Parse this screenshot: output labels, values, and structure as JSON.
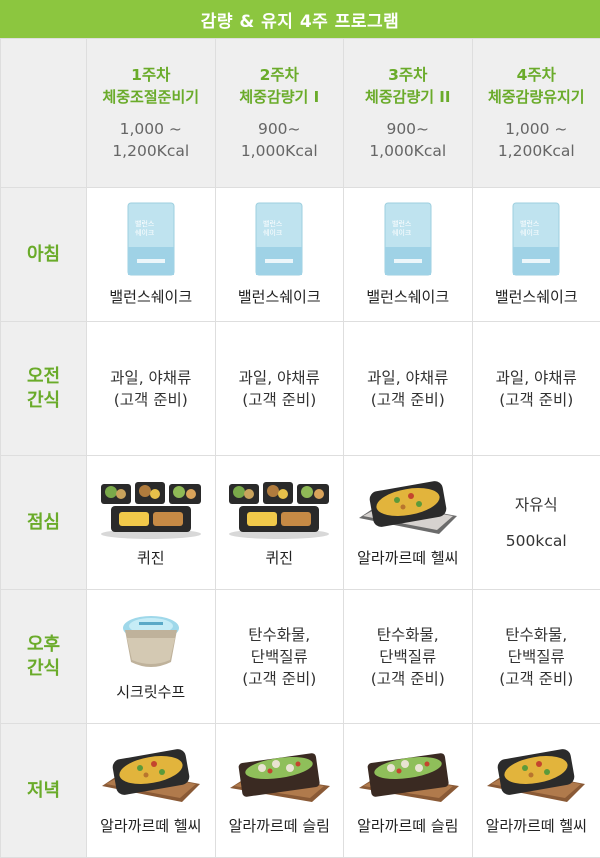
{
  "title": "감량 & 유지 4주 프로그램",
  "weeks": [
    {
      "label": "1주차",
      "phase": "체중조절준비기",
      "kcal_line1": "1,000 ~",
      "kcal_line2": "1,200Kcal"
    },
    {
      "label": "2주차",
      "phase": "체중감량기 I",
      "kcal_line1": "900~",
      "kcal_line2": "1,000Kcal"
    },
    {
      "label": "3주차",
      "phase": "체중감량기 II",
      "kcal_line1": "900~",
      "kcal_line2": "1,000Kcal"
    },
    {
      "label": "4주차",
      "phase": "체중감량유지기",
      "kcal_line1": "1,000 ~",
      "kcal_line2": "1,200Kcal"
    }
  ],
  "rows": {
    "breakfast": {
      "label": "아침",
      "cells": [
        "밸런스쉐이크",
        "밸런스쉐이크",
        "밸런스쉐이크",
        "밸런스쉐이크"
      ],
      "pack_text": "밸런스\n쉐이크"
    },
    "am_snack": {
      "label_line1": "오전",
      "label_line2": "간식",
      "cells": [
        {
          "line1": "과일, 야채류",
          "line2": "(고객 준비)"
        },
        {
          "line1": "과일, 야채류",
          "line2": "(고객 준비)"
        },
        {
          "line1": "과일, 야채류",
          "line2": "(고객 준비)"
        },
        {
          "line1": "과일, 야채류",
          "line2": "(고객 준비)"
        }
      ]
    },
    "lunch": {
      "label": "점심",
      "cells": [
        "퀴진",
        "퀴진",
        "알라까르떼 헬씨"
      ],
      "free": {
        "line1": "자유식",
        "line2": "500kcal"
      }
    },
    "pm_snack": {
      "label_line1": "오후",
      "label_line2": "간식",
      "soup": "시크릿수프",
      "cells": [
        {
          "line1": "탄수화물,",
          "line2": "단백질류",
          "line3": "(고객 준비)"
        },
        {
          "line1": "탄수화물,",
          "line2": "단백질류",
          "line3": "(고객 준비)"
        },
        {
          "line1": "탄수화물,",
          "line2": "단백질류",
          "line3": "(고객 준비)"
        }
      ]
    },
    "dinner": {
      "label": "저녁",
      "cells": [
        "알라까르떼 헬씨",
        "알라까르떼 슬림",
        "알라까르떼 슬림",
        "알라까르떼 헬씨"
      ]
    }
  },
  "colors": {
    "accent": "#8cc63f",
    "label_green": "#6aab2a",
    "header_bg": "#efefef"
  }
}
